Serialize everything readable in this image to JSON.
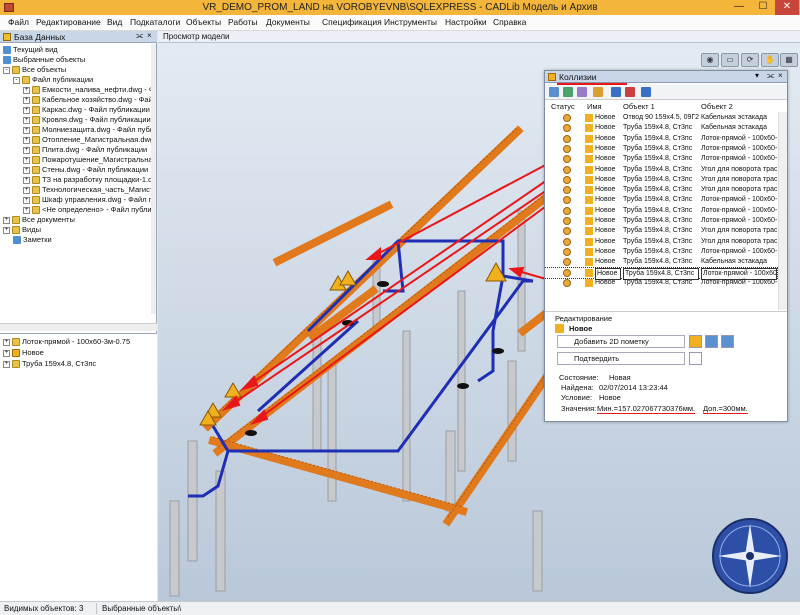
{
  "window": {
    "title": "VR_DEMO_PROM_LAND на VOROBYEVNB\\SQLEXPRESS - CADLib Модель и Архив",
    "minimize": "—",
    "maximize": "☐",
    "close": "✕"
  },
  "menu": [
    "Файл",
    "Редактирование",
    "Вид",
    "Подкаталоги",
    "Объекты",
    "Работы",
    "Документы",
    "Спецификация",
    "Инструменты",
    "Настройки",
    "Справка"
  ],
  "left_panel": {
    "title": "База Данных",
    "pin": "⫘",
    "close": "×",
    "tree": [
      {
        "label": "Текущий вид",
        "icon": "view-icon"
      },
      {
        "label": "Выбранные объекты",
        "icon": "selection-icon"
      },
      {
        "label": "Все объекты",
        "icon": "folder-icon"
      },
      {
        "label": "Файл публикации",
        "icon": "folder-icon"
      },
      {
        "label": "Емкости_налива_нефти.dwg - Фа",
        "icon": "folder-icon"
      },
      {
        "label": "Кабельное хозяйство.dwg - Файл",
        "icon": "folder-icon"
      },
      {
        "label": "Каркас.dwg - Файл публикации",
        "icon": "folder-icon"
      },
      {
        "label": "Кровля.dwg - Файл публикации",
        "icon": "folder-icon"
      },
      {
        "label": "Молниезащита.dwg - Файл публи",
        "icon": "folder-icon"
      },
      {
        "label": "Отопление_Магистральная.dwg",
        "icon": "folder-icon"
      },
      {
        "label": "Плита.dwg - Файл публикации",
        "icon": "folder-icon"
      },
      {
        "label": "Пожаротушение_Магистральная",
        "icon": "folder-icon"
      },
      {
        "label": "Стены.dwg - Файл публикации",
        "icon": "folder-icon"
      },
      {
        "label": "ТЗ на разработку площадки-1.dw",
        "icon": "folder-icon"
      },
      {
        "label": "Технологическая_часть_Магистр",
        "icon": "folder-icon"
      },
      {
        "label": "Шкаф управления.dwg - Файл пу",
        "icon": "folder-icon"
      },
      {
        "label": "<Не определено> - Файл публика",
        "icon": "folder-icon"
      },
      {
        "label": "Все документы",
        "icon": "folder-icon"
      },
      {
        "label": "Виды",
        "icon": "folder-icon"
      },
      {
        "label": "Заметки",
        "icon": "note-icon"
      }
    ],
    "bottom_list": [
      {
        "label": "Лоток-прямой - 100x60-3м-0.75"
      },
      {
        "label": "Новое"
      },
      {
        "label": "Труба 159x4.8, Ст3пс"
      }
    ]
  },
  "viewport": {
    "tab": "Просмотр модели"
  },
  "collisions": {
    "title": "Коллизии",
    "columns": [
      "Статус",
      "Имя",
      "Объект 1",
      "Объект 2"
    ],
    "rows": [
      {
        "name": "Новое",
        "obj1": "Отвод 90 159x4.5, 09Г2С",
        "obj2": "Кабельная эстакада"
      },
      {
        "name": "Новое",
        "obj1": "Труба 159x4.8, Ст3пс",
        "obj2": "Кабельная эстакада"
      },
      {
        "name": "Новое",
        "obj1": "Труба 159x4.8, Ст3пс",
        "obj2": "Лоток-прямой - 100x60-"
      },
      {
        "name": "Новое",
        "obj1": "Труба 159x4.8, Ст3пс",
        "obj2": "Лоток-прямой - 100x60-"
      },
      {
        "name": "Новое",
        "obj1": "Труба 159x4.8, Ст3пс",
        "obj2": "Лоток-прямой - 100x60-"
      },
      {
        "name": "Новое",
        "obj1": "Труба 159x4.8, Ст3пс",
        "obj2": "Угол для поворота трас"
      },
      {
        "name": "Новое",
        "obj1": "Труба 159x4.8, Ст3пс",
        "obj2": "Угол для поворота трас"
      },
      {
        "name": "Новое",
        "obj1": "Труба 159x4.8, Ст3пс",
        "obj2": "Угол для поворота трас"
      },
      {
        "name": "Новое",
        "obj1": "Труба 159x4.8, Ст3пс",
        "obj2": "Лоток-прямой - 100x60-"
      },
      {
        "name": "Новое",
        "obj1": "Труба 159x4.8, Ст3пс",
        "obj2": "Лоток-прямой - 100x60-"
      },
      {
        "name": "Новое",
        "obj1": "Труба 159x4.8, Ст3пс",
        "obj2": "Лоток-прямой - 100x60-"
      },
      {
        "name": "Новое",
        "obj1": "Труба 159x4.8, Ст3пс",
        "obj2": "Угол для поворота трас"
      },
      {
        "name": "Новое",
        "obj1": "Труба 159x4.8, Ст3пс",
        "obj2": "Угол для поворота трас"
      },
      {
        "name": "Новое",
        "obj1": "Труба 159x4.8, Ст3пс",
        "obj2": "Лоток-прямой - 100x60-"
      },
      {
        "name": "Новое",
        "obj1": "Труба 159x4.8, Ст3пс",
        "obj2": "Кабельная эстакада"
      },
      {
        "name": "Новое",
        "obj1": "Труба 159x4.8, Ст3пс",
        "obj2": "Лоток-прямой - 100x60-"
      },
      {
        "name": "Новое",
        "obj1": "Труба 159x4.8, Ст3пс",
        "obj2": "Лоток-прямой - 100x60-"
      }
    ],
    "selected_row": 15,
    "edit": {
      "section": "Редактирование",
      "name": "Новое",
      "add_2d": "Добавить 2D пометку",
      "confirm": "Подтвердить",
      "state_label": "Состояние:",
      "state_value": "Новая",
      "found_label": "Найдена:",
      "found_value": "02/07/2014 13:23:44",
      "condition_label": "Условие:",
      "condition_value": "Новое",
      "values_label": "Значения:",
      "values_min": "Мин.=157.027067730376мм.",
      "values_allowed": "Доп.=300мм."
    }
  },
  "status": {
    "visible": "Видимых объектов: 3",
    "selected": "Выбранные объекты\\"
  },
  "colors": {
    "accent_title": "#f3b53a",
    "cable_tray": "#e07a1c",
    "pipe": "#1f2fb5",
    "highlight_red": "#e8171a"
  }
}
